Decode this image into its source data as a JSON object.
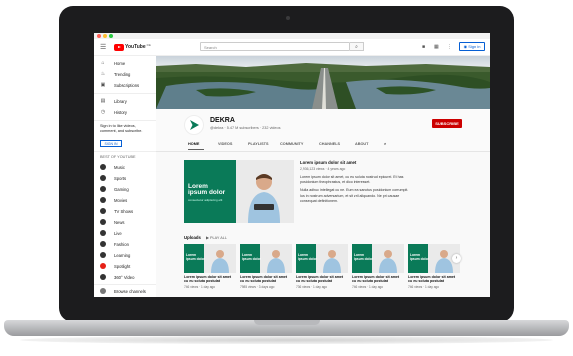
{
  "browser": {
    "dots": [
      "#ff5f57",
      "#febc2e",
      "#28c840"
    ]
  },
  "youtube": {
    "logo_text": "YouTube",
    "logo_sup": "DE",
    "search_placeholder": "Search",
    "sign_in": "Sign in"
  },
  "sidebar": {
    "main_items": [
      {
        "label": "Home",
        "icon": "home-icon"
      },
      {
        "label": "Trending",
        "icon": "flame-icon"
      },
      {
        "label": "Subscriptions",
        "icon": "subscriptions-icon"
      }
    ],
    "library_items": [
      {
        "label": "Library",
        "icon": "library-icon"
      },
      {
        "label": "History",
        "icon": "history-icon"
      }
    ],
    "prompt": "Sign in to like videos, comment, and subscribe.",
    "sign_in": "SIGN IN",
    "best_of_heading": "BEST OF YOUTUBE",
    "best_of_items": [
      {
        "label": "Music",
        "color": "#333333"
      },
      {
        "label": "Sports",
        "color": "#333333"
      },
      {
        "label": "Gaming",
        "color": "#333333"
      },
      {
        "label": "Movies",
        "color": "#333333"
      },
      {
        "label": "TV Shows",
        "color": "#333333"
      },
      {
        "label": "News",
        "color": "#333333"
      },
      {
        "label": "Live",
        "color": "#333333"
      },
      {
        "label": "Fashion",
        "color": "#333333"
      },
      {
        "label": "Learning",
        "color": "#333333"
      },
      {
        "label": "Spotlight",
        "color": "#e62117"
      },
      {
        "label": "360° Video",
        "color": "#333333"
      }
    ],
    "browse": "Browse channels"
  },
  "channel": {
    "name": "DEKRA",
    "meta": "@dekra · 5.47 M subscribers · 232 videos",
    "subscribe": "SUBSCRIBE",
    "brand_color": "#0a7a58",
    "tabs": [
      "HOME",
      "VIDEOS",
      "PLAYLISTS",
      "COMMUNITY",
      "CHANNELS",
      "ABOUT"
    ]
  },
  "featured": {
    "thumb_text_1": "Lorem",
    "thumb_text_2": "ipsum dolor",
    "thumb_sub": "consectetur adipiscing elit",
    "title": "Lorem ipsum dolor sit amet",
    "meta": "2,936,123 views · 4 years ago",
    "desc_1": "Lorem ipsum dolor sit amet, cu eu soluta nostrud epicurei. Et has posidonium theophrastus, et dico interesset.",
    "desc_2": "Nulla adhuc intellegat cu ne. Eum ea sanctus posidonium corrumpit. Ius in nostrum adversarium, et sit zril aliquando. Ne pri causae consequat definitionem."
  },
  "uploads": {
    "heading": "Uploads",
    "play_all": "PLAY ALL",
    "videos": [
      {
        "title": "Lorem ipsum dolor sit amet cu eu soluta postulat",
        "meta": "746 views · 1 day ago"
      },
      {
        "title": "Lorem ipsum dolor sit amet cu eu soluta postulat",
        "meta": "7985 views · 3 days ago"
      },
      {
        "title": "Lorem ipsum dolor sit amet cu eu soluta postulat",
        "meta": "736 views · 1 day ago"
      },
      {
        "title": "Lorem ipsum dolor sit amet cu eu soluta postulat",
        "meta": "746 views · 1 day ago"
      },
      {
        "title": "Lorem ipsum dolor sit amet cu eu soluta postulat",
        "meta": "746 views · 1 day ago"
      }
    ]
  }
}
